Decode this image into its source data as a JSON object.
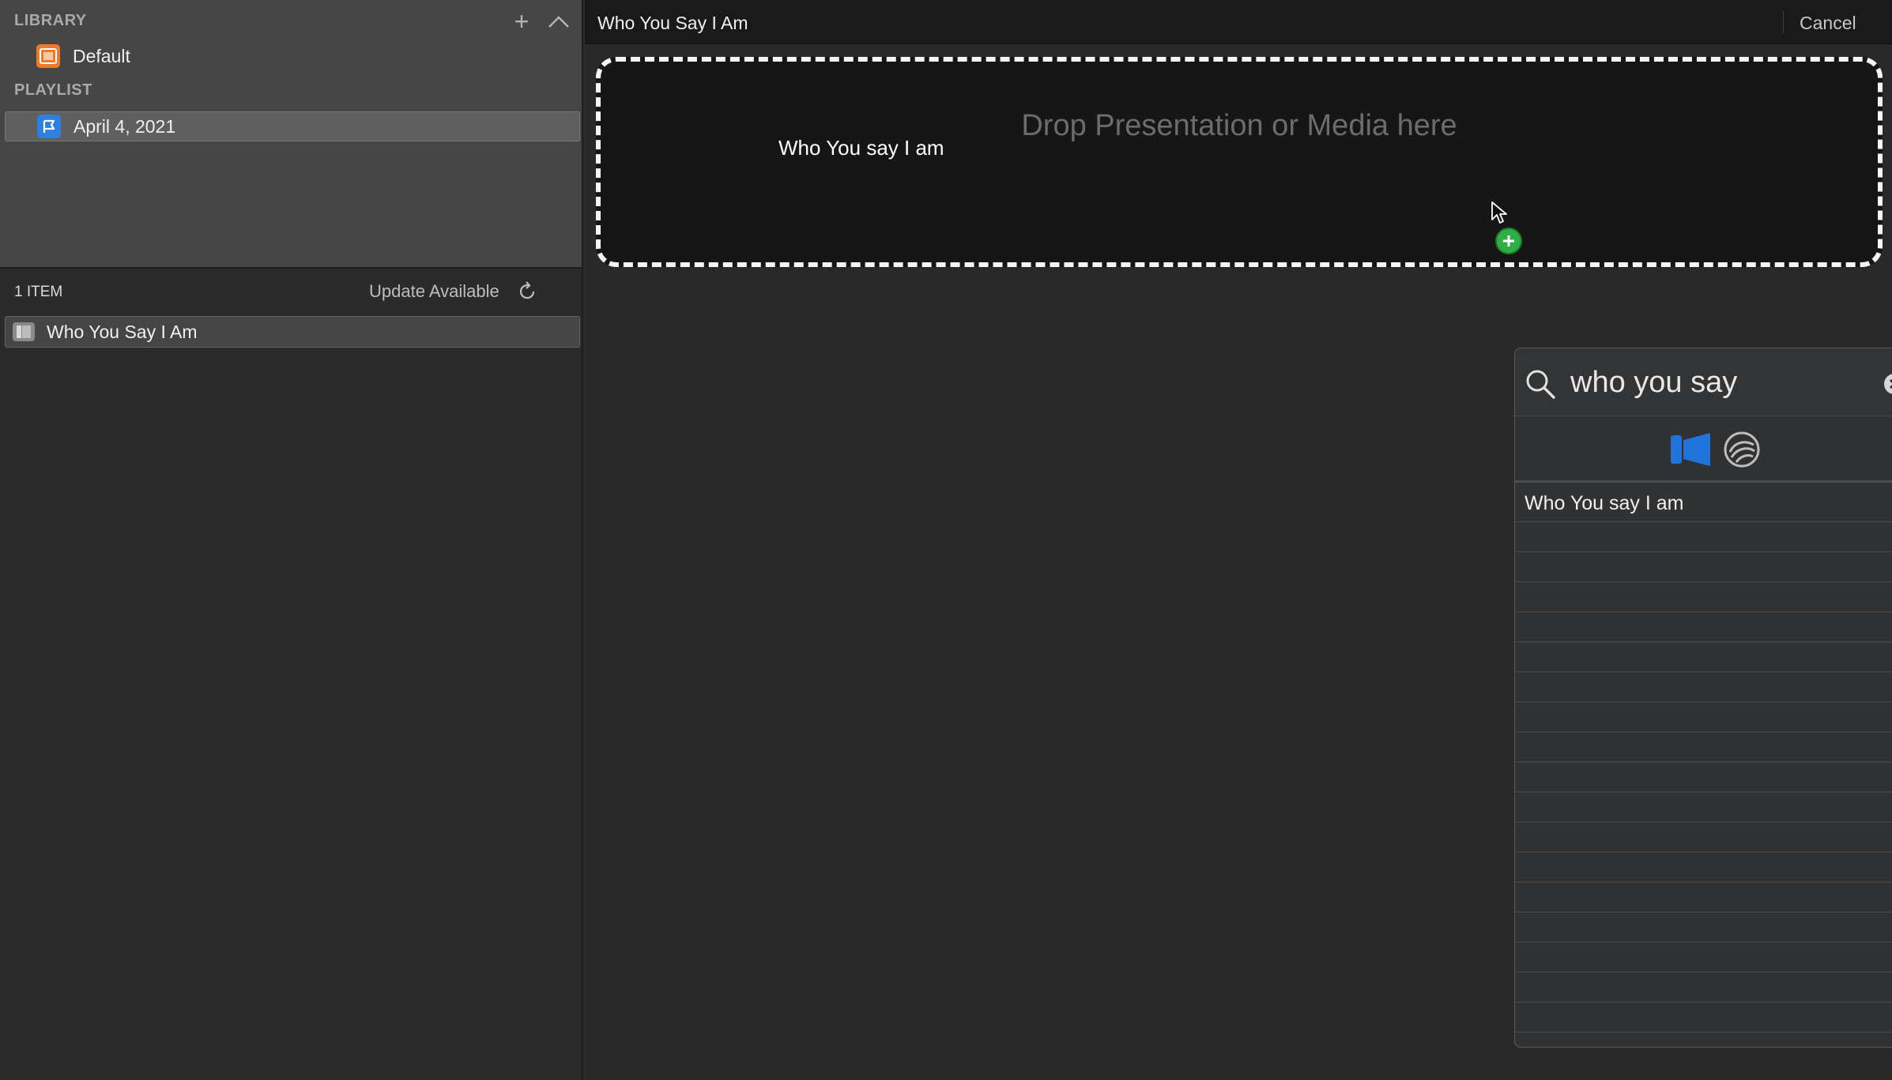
{
  "sidebar": {
    "library_header": "LIBRARY",
    "library_items": [
      {
        "label": "Default",
        "icon": "presentation-icon",
        "color": "#ef7a2c"
      }
    ],
    "playlist_header": "PLAYLIST",
    "playlist_items": [
      {
        "label": "April 4, 2021",
        "icon": "flag-icon",
        "color": "#2d7fe0",
        "selected": true
      }
    ],
    "items_count": "1 ITEM",
    "update_label": "Update Available",
    "items": [
      {
        "label": "Who You Say I Am",
        "icon": "presentation-icon"
      }
    ]
  },
  "main": {
    "title": "Who You Say I Am",
    "cancel_label": "Cancel",
    "drop_zone_text": "Drop Presentation or Media here",
    "drag_item_label": "Who You say I am"
  },
  "search": {
    "query": "who you say",
    "filters": [
      {
        "name": "presentations",
        "icon": "presentation-icon",
        "active": true,
        "color": "#1f73d9"
      },
      {
        "name": "ccli",
        "icon": "ccli-icon",
        "active": false
      }
    ],
    "results": [
      "Who You say I am"
    ]
  }
}
